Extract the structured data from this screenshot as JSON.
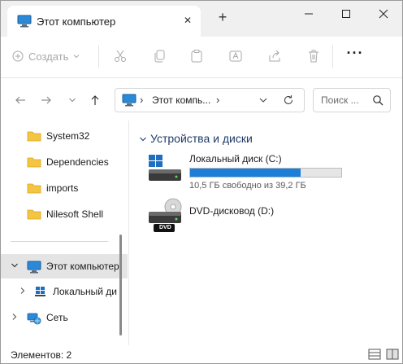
{
  "tab": {
    "title": "Этот компьютер",
    "close_glyph": "✕",
    "new_tab_glyph": "+"
  },
  "window_controls": {
    "minimize_glyph": "—",
    "maximize_glyph": "☐",
    "close_glyph": "✕"
  },
  "commandbar": {
    "create_label": "Создать",
    "more_glyph": "···"
  },
  "navigation": {
    "back_glyph": "←",
    "forward_glyph": "→",
    "recent_glyph": "⌄",
    "up_glyph": "↑"
  },
  "address": {
    "location_label": "Этот компь...",
    "separator": "›"
  },
  "search": {
    "placeholder": "Поиск ..."
  },
  "sidebar": {
    "quick_items": [
      {
        "label": "System32",
        "icon": "folder-icon"
      },
      {
        "label": "Dependencies",
        "icon": "folder-icon"
      },
      {
        "label": "imports",
        "icon": "folder-icon"
      },
      {
        "label": "Nilesoft Shell",
        "icon": "folder-icon"
      }
    ],
    "this_pc": {
      "label": "Этот компьютер",
      "icon": "computer-icon"
    },
    "local_disk": {
      "label": "Локальный ди",
      "icon": "windows-drive-icon"
    },
    "network": {
      "label": "Сеть",
      "icon": "network-icon"
    }
  },
  "content": {
    "group_title": "Устройства и диски",
    "drives": [
      {
        "name": "Локальный диск (C:)",
        "free_text": "10,5 ГБ свободно из 39,2 ГБ",
        "used_fraction": 0.732,
        "icon": "windows-drive-icon"
      },
      {
        "name": "DVD-дисковод (D:)",
        "badge": "DVD",
        "icon": "dvd-drive-icon"
      }
    ]
  },
  "status": {
    "item_count_text": "Элементов: 2"
  },
  "colors": {
    "accent": "#1c7ed6",
    "folder": "#f4c542",
    "group_title": "#1e3a6a"
  }
}
